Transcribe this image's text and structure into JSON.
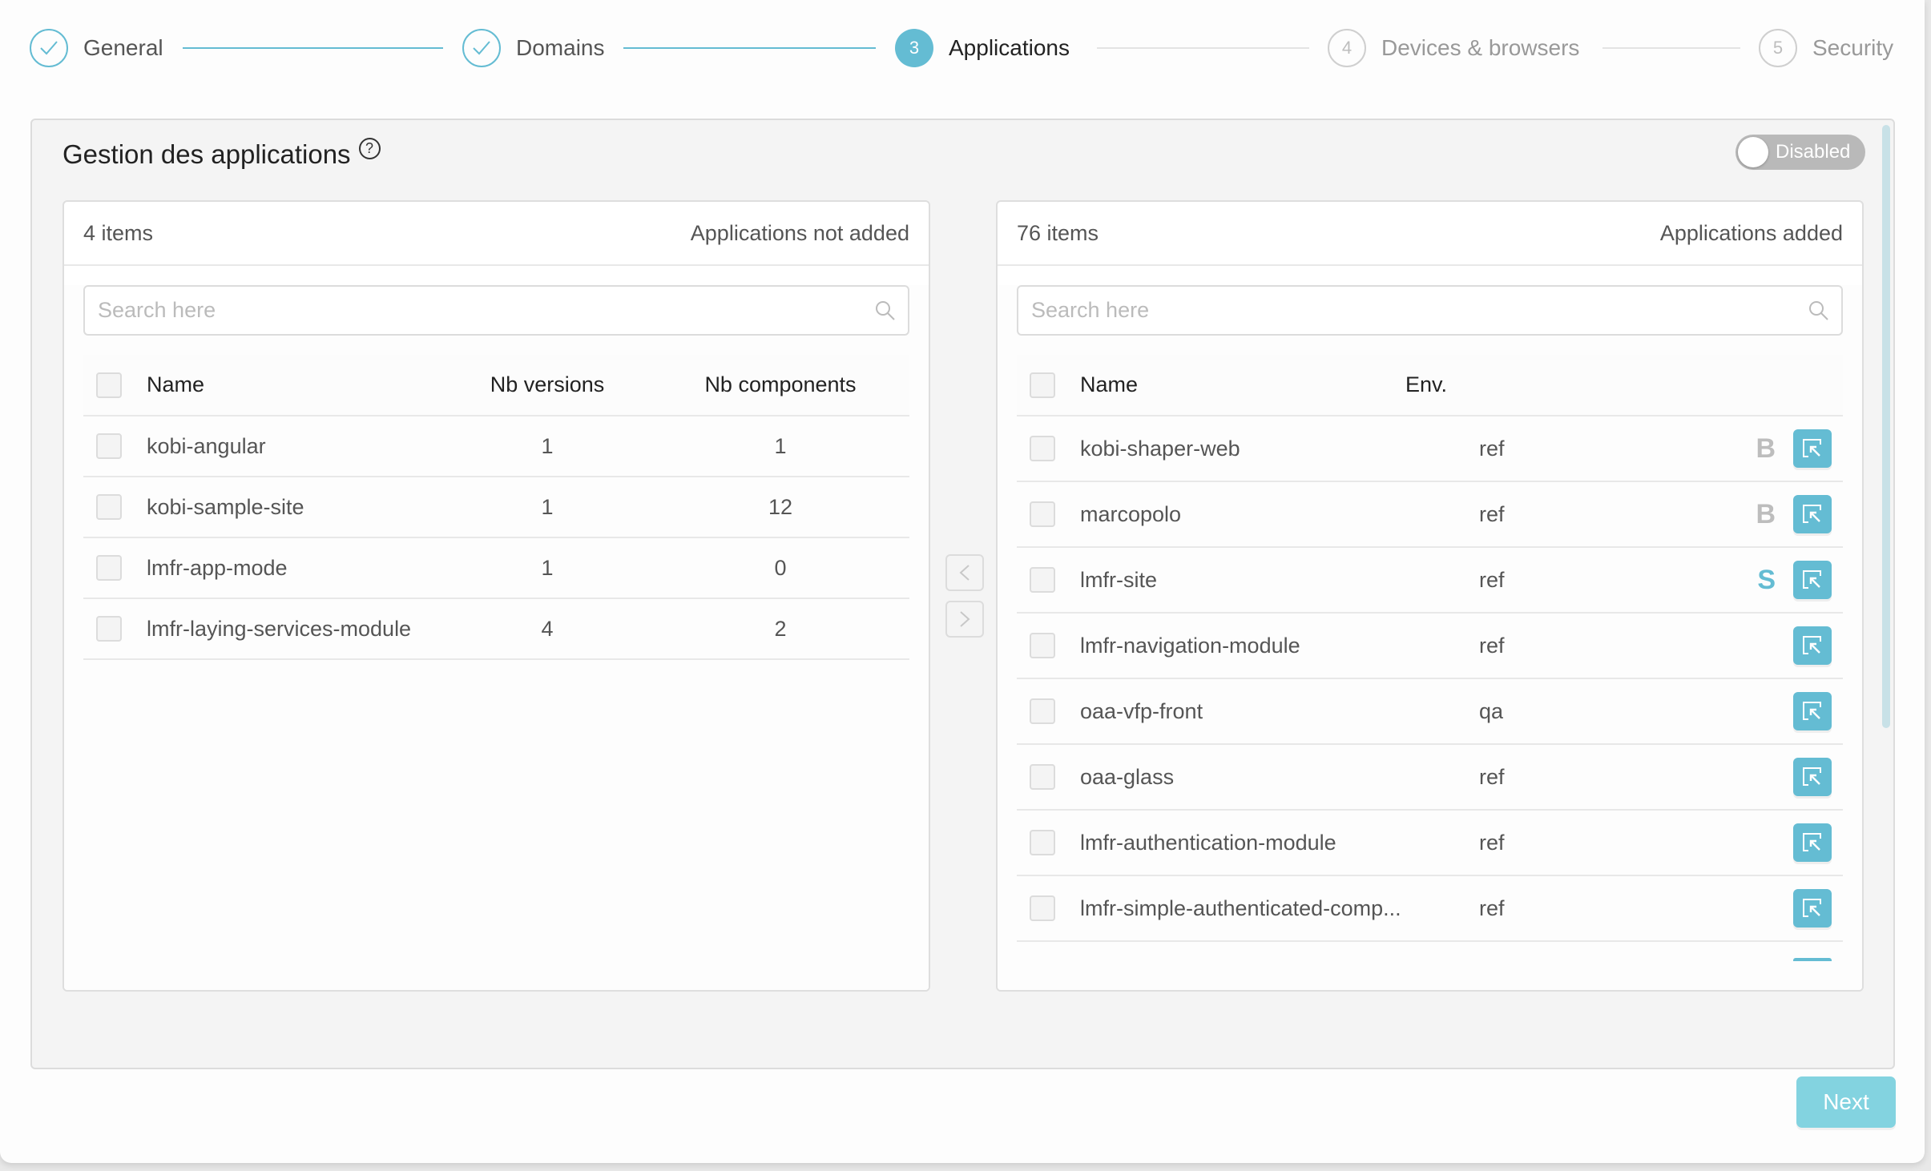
{
  "stepper": {
    "steps": [
      {
        "number": "1",
        "label": "General",
        "state": "done"
      },
      {
        "number": "2",
        "label": "Domains",
        "state": "done"
      },
      {
        "number": "3",
        "label": "Applications",
        "state": "active"
      },
      {
        "number": "4",
        "label": "Devices & browsers",
        "state": "todo"
      },
      {
        "number": "5",
        "label": "Security",
        "state": "todo"
      }
    ]
  },
  "gestion": {
    "title": "Gestion des applications",
    "help_icon": "question-circle-icon",
    "toggle": {
      "label": "Disabled",
      "enabled": false
    }
  },
  "left_list": {
    "count": "4 items",
    "title": "Applications not added",
    "search_placeholder": "Search here",
    "search_value": "",
    "columns": [
      "Name",
      "Nb versions",
      "Nb components"
    ],
    "rows": [
      {
        "name": "kobi-angular",
        "versions": "1",
        "components": "1"
      },
      {
        "name": "kobi-sample-site",
        "versions": "1",
        "components": "12"
      },
      {
        "name": "lmfr-app-mode",
        "versions": "1",
        "components": "0"
      },
      {
        "name": "lmfr-laying-services-module",
        "versions": "4",
        "components": "2"
      }
    ]
  },
  "transfer": {
    "left_arrow": "<",
    "right_arrow": ">"
  },
  "right_list": {
    "count": "76 items",
    "title": "Applications added",
    "search_placeholder": "Search here",
    "search_value": "",
    "columns": [
      "Name",
      "Env."
    ],
    "rows": [
      {
        "name": "kobi-shaper-web",
        "env": "ref",
        "badge": "B"
      },
      {
        "name": "marcopolo",
        "env": "ref",
        "badge": "B"
      },
      {
        "name": "lmfr-site",
        "env": "ref",
        "badge": "S"
      },
      {
        "name": "lmfr-navigation-module",
        "env": "ref",
        "badge": ""
      },
      {
        "name": "oaa-vfp-front",
        "env": "qa",
        "badge": ""
      },
      {
        "name": "oaa-glass",
        "env": "ref",
        "badge": ""
      },
      {
        "name": "lmfr-authentication-module",
        "env": "ref",
        "badge": ""
      },
      {
        "name": "lmfr-simple-authenticated-comp...",
        "env": "ref",
        "badge": ""
      }
    ]
  },
  "footer": {
    "next_label": "Next"
  },
  "colors": {
    "accent": "#64bcd3",
    "next_button": "#83d3e0",
    "badge_b": "#bdbdbd",
    "toggle_off": "#b9b9b9"
  }
}
